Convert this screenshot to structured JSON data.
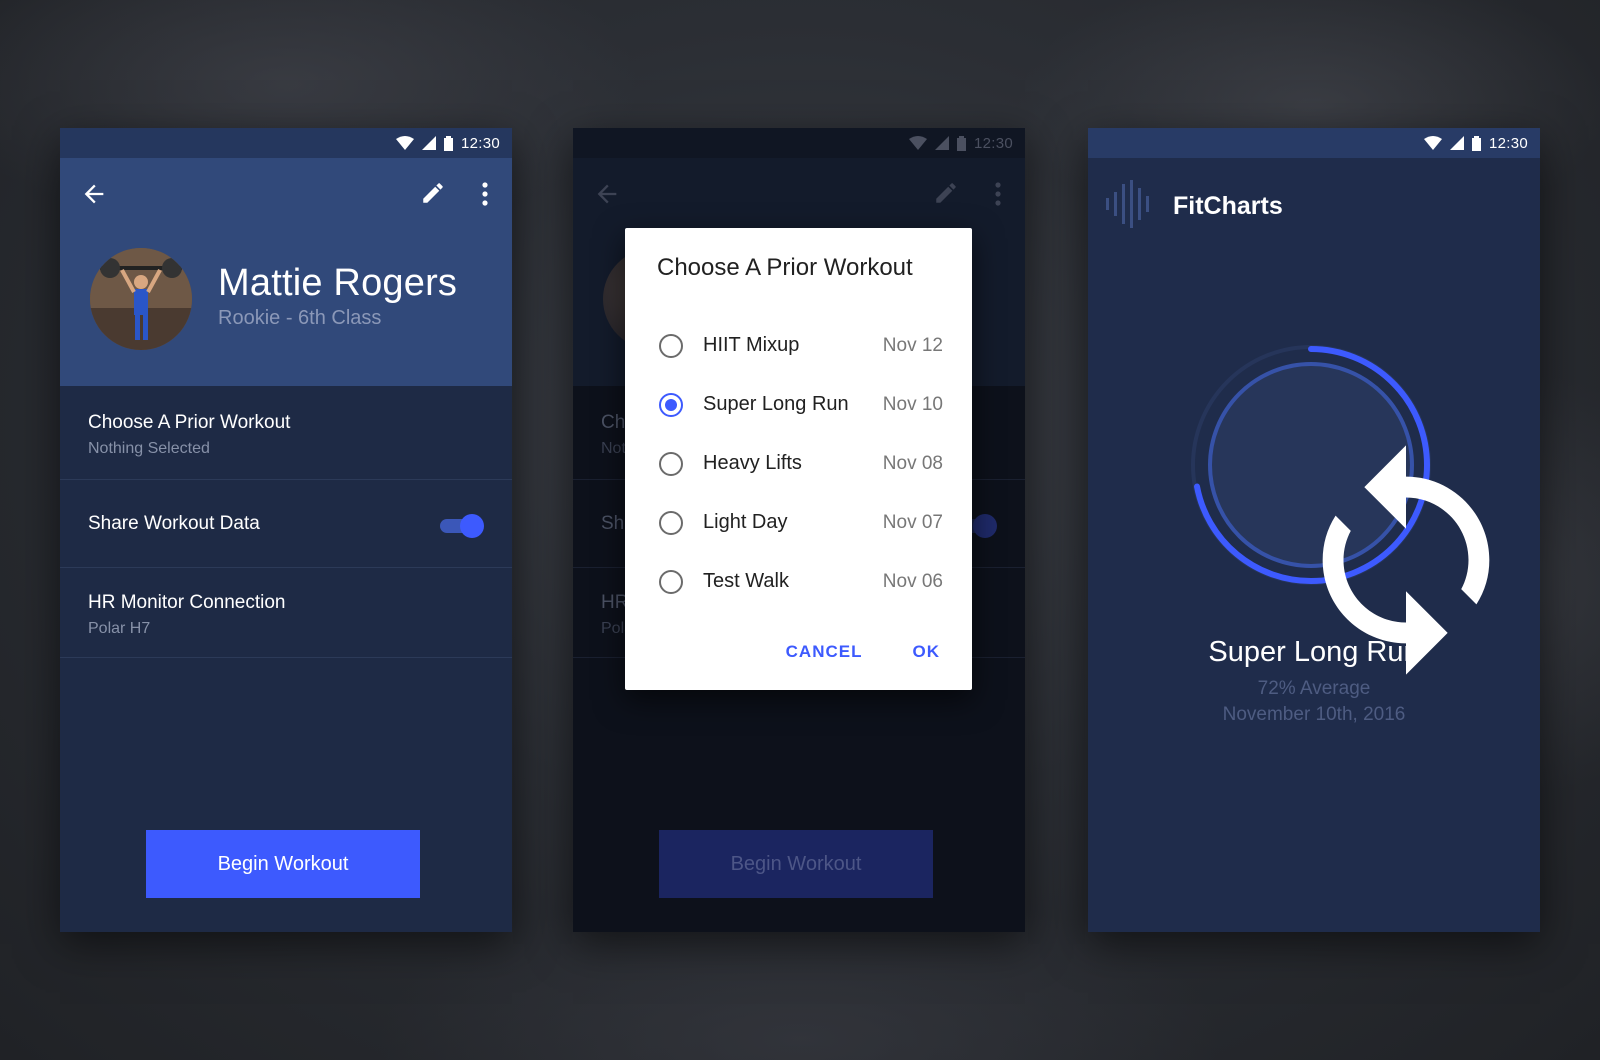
{
  "status": {
    "time": "12:30"
  },
  "profile": {
    "name": "Mattie Rogers",
    "rank": "Rookie - 6th Class"
  },
  "settings": {
    "prior_title": "Choose A Prior Workout",
    "prior_value": "Nothing Selected",
    "share_title": "Share Workout Data",
    "share_enabled": true,
    "hr_title": "HR Monitor Connection",
    "hr_value": "Polar H7"
  },
  "begin_label": "Begin Workout",
  "dialog": {
    "title": "Choose A Prior Workout",
    "options": [
      {
        "label": "HIIT Mixup",
        "date": "Nov 12",
        "selected": false
      },
      {
        "label": "Super Long Run",
        "date": "Nov 10",
        "selected": true
      },
      {
        "label": "Heavy Lifts",
        "date": "Nov 08",
        "selected": false
      },
      {
        "label": "Light Day",
        "date": "Nov 07",
        "selected": false
      },
      {
        "label": "Test Walk",
        "date": "Nov 06",
        "selected": false
      }
    ],
    "cancel_label": "CANCEL",
    "ok_label": "OK"
  },
  "fitcharts": {
    "app_title": "FitCharts",
    "workout_name": "Super Long Run",
    "average": "72% Average",
    "date": "November 10th, 2016",
    "progress": 0.72
  },
  "colors": {
    "accent": "#3d5afe",
    "header": "#31497a",
    "panel": "#1e2a45"
  }
}
